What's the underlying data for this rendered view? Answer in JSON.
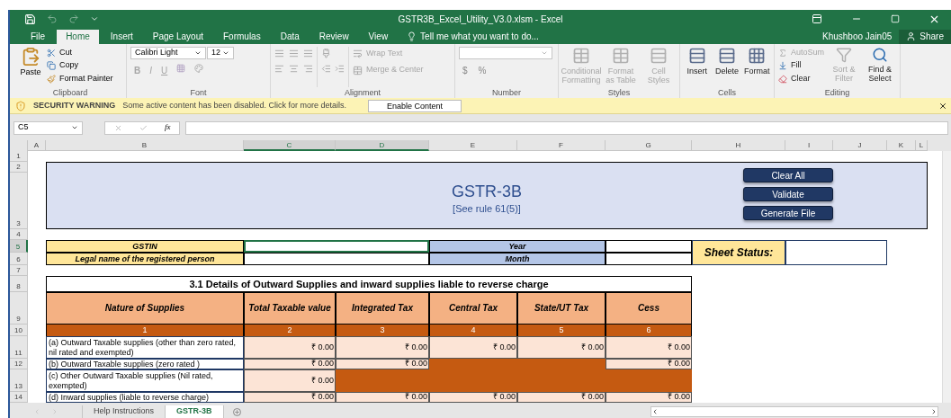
{
  "window": {
    "title": "GSTR3B_Excel_Utility_V3.0.xlsm - Excel",
    "user": "Khushboo Jain05",
    "share": "Share"
  },
  "ribbon_tabs": [
    {
      "label": "File",
      "selected": false
    },
    {
      "label": "Home",
      "selected": true
    },
    {
      "label": "Insert",
      "selected": false
    },
    {
      "label": "Page Layout",
      "selected": false
    },
    {
      "label": "Formulas",
      "selected": false
    },
    {
      "label": "Data",
      "selected": false
    },
    {
      "label": "Review",
      "selected": false
    },
    {
      "label": "View",
      "selected": false
    }
  ],
  "tell_me": "Tell me what you want to do...",
  "ribbon": {
    "clipboard": {
      "label": "Clipboard",
      "paste": "Paste",
      "cut": "Cut",
      "copy": "Copy",
      "format_painter": "Format Painter"
    },
    "font": {
      "label": "Font",
      "font_name": "Calibri Light",
      "font_size": "12",
      "styles": [
        {
          "label": "B",
          "disabled": true
        },
        {
          "label": "I",
          "disabled": true
        },
        {
          "label": "U",
          "disabled": true
        }
      ]
    },
    "alignment": {
      "label": "Alignment",
      "buttons": [
        {
          "label": "Wrap Text",
          "disabled": true
        },
        {
          "label": "Merge & Center",
          "disabled": true
        }
      ]
    },
    "number": {
      "label": "Number",
      "symbols": [
        "$",
        "%"
      ]
    },
    "styles": {
      "label": "Styles",
      "items": [
        {
          "label": "Conditional Formatting",
          "disabled": true
        },
        {
          "label": "Format as Table",
          "disabled": true
        },
        {
          "label": "Cell Styles",
          "disabled": true
        }
      ]
    },
    "cells": {
      "label": "Cells",
      "items": [
        {
          "label": "Insert",
          "disabled": false
        },
        {
          "label": "Delete",
          "disabled": false
        },
        {
          "label": "Format",
          "disabled": false
        }
      ]
    },
    "editing": {
      "label": "Editing",
      "items": [
        {
          "label": "AutoSum",
          "disabled": true
        },
        {
          "label": "Fill",
          "disabled": false
        },
        {
          "label": "Clear",
          "disabled": false
        }
      ],
      "big": [
        {
          "label": "Sort & Filter",
          "disabled": true
        },
        {
          "label": "Find & Select",
          "disabled": false
        }
      ]
    }
  },
  "security_bar": {
    "label": "SECURITY WARNING",
    "message": "Some active content has been disabled. Click for more details.",
    "button": "Enable Content"
  },
  "formula_bar": {
    "name_box": "C5",
    "fx": "fx"
  },
  "columns": [
    {
      "label": "A",
      "selected": false
    },
    {
      "label": "B",
      "selected": false
    },
    {
      "label": "C",
      "selected": true
    },
    {
      "label": "D",
      "selected": true
    },
    {
      "label": "E",
      "selected": false
    },
    {
      "label": "F",
      "selected": false
    },
    {
      "label": "G",
      "selected": false
    },
    {
      "label": "H",
      "selected": false
    },
    {
      "label": "I",
      "selected": false
    },
    {
      "label": "J",
      "selected": false
    },
    {
      "label": "K",
      "selected": false
    },
    {
      "label": "L",
      "selected": false
    }
  ],
  "rows": [
    {
      "label": "1",
      "selected": false
    },
    {
      "label": "2",
      "selected": false
    },
    {
      "label": "3",
      "selected": false
    },
    {
      "label": "4",
      "selected": false
    },
    {
      "label": "5",
      "selected": true
    },
    {
      "label": "6",
      "selected": false
    },
    {
      "label": "7",
      "selected": false
    },
    {
      "label": "8",
      "selected": false
    },
    {
      "label": "9",
      "selected": false
    },
    {
      "label": "10",
      "selected": false
    },
    {
      "label": "11",
      "selected": false
    },
    {
      "label": "12",
      "selected": false
    },
    {
      "label": "13",
      "selected": false
    },
    {
      "label": "14",
      "selected": false
    }
  ],
  "banner": {
    "title": "GSTR-3B",
    "subtitle": "[See rule 61(5)]",
    "buttons": [
      "Clear All",
      "Validate",
      "Generate File"
    ]
  },
  "info": {
    "gstin": "GSTIN",
    "legal_name": "Legal name of the registered person",
    "year": "Year",
    "month": "Month",
    "sheet_status": "Sheet Status:"
  },
  "table": {
    "title": "3.1 Details of Outward Supplies and inward supplies liable to reverse charge",
    "headers": [
      "Nature of Supplies",
      "Total Taxable value",
      "Integrated Tax",
      "Central Tax",
      "State/UT Tax",
      "Cess"
    ],
    "numbers": [
      "1",
      "2",
      "3",
      "4",
      "5",
      "6"
    ],
    "rows": [
      {
        "label": "(a) Outward Taxable  supplies  (other than zero rated, nil rated and exempted)",
        "cells": [
          {
            "kind": "amount",
            "value": "₹ 0.00"
          },
          {
            "kind": "amount",
            "value": "₹ 0.00"
          },
          {
            "kind": "amount",
            "value": "₹ 0.00"
          },
          {
            "kind": "amount",
            "value": "₹ 0.00"
          },
          {
            "kind": "amount",
            "value": "₹ 0.00"
          }
        ]
      },
      {
        "label": "(b) Outward Taxable  supplies  (zero rated )",
        "cells": [
          {
            "kind": "amount",
            "value": "₹ 0.00"
          },
          {
            "kind": "amount",
            "value": "₹ 0.00"
          },
          {
            "kind": "blocked"
          },
          {
            "kind": "blocked"
          },
          {
            "kind": "amount",
            "value": "₹ 0.00"
          }
        ]
      },
      {
        "label": "(c) Other Outward Taxable  supplies (Nil rated, exempted)",
        "cells": [
          {
            "kind": "amount",
            "value": "₹ 0.00"
          },
          {
            "kind": "blocked"
          },
          {
            "kind": "blocked"
          },
          {
            "kind": "blocked"
          },
          {
            "kind": "blocked"
          }
        ]
      },
      {
        "label": "(d) Inward supplies (liable to reverse charge)",
        "cells": [
          {
            "kind": "amount",
            "value": "₹ 0.00"
          },
          {
            "kind": "amount",
            "value": "₹ 0.00"
          },
          {
            "kind": "amount",
            "value": "₹ 0.00"
          },
          {
            "kind": "amount",
            "value": "₹ 0.00"
          },
          {
            "kind": "amount",
            "value": "₹ 0.00"
          }
        ]
      }
    ]
  },
  "sheet_tabs": [
    {
      "label": "Help Instructions",
      "selected": false
    },
    {
      "label": "GSTR-3B",
      "selected": true
    }
  ]
}
